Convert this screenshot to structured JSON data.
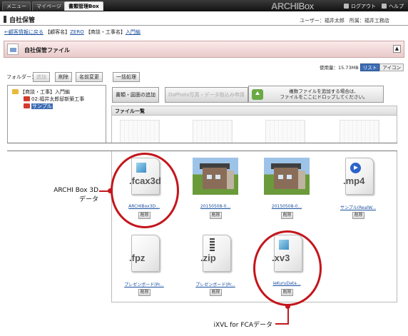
{
  "topbar": {
    "tabs": [
      "メニュー",
      "マイページ",
      "書類管理Box"
    ],
    "brand_a": "ARCHI",
    "brand_b": "Box",
    "logout": "ログアウト",
    "help": "ヘルプ"
  },
  "header": {
    "title": "自社保管",
    "user": "ユーザー：福井太郎　所属：福井工務店"
  },
  "breadcrumb": {
    "back": "←顧客情報に戻る",
    "customer_label": "【顧客名】",
    "customer": "ZERO",
    "deal_label": "【商談・工事名】",
    "deal": "入門編"
  },
  "section": {
    "title": "自社保管ファイル",
    "collapse": "▲"
  },
  "usage": {
    "text": "使用量：15.73MB",
    "list": "リスト",
    "icon": "アイコン"
  },
  "folder_toolbar": {
    "label": "フォルダー：",
    "add": "追加",
    "delete": "削除",
    "rename": "名前変更",
    "bulk": "一括処理"
  },
  "tree": {
    "root": "【商談・工事】入門編",
    "child1": "02:福井太郎邸新築工事",
    "child2": "サンプル"
  },
  "actions": {
    "add_doc": "書類・図面の追加",
    "dophoto": "DoPhoto写真・データ取込み申請",
    "drop_line1": "複数ファイルを追加する場合は、",
    "drop_line2": "ファイルをここにドロップしてください。"
  },
  "filelist": {
    "heading": "ファイル一覧",
    "delete_label": "削除",
    "files": [
      {
        "name": "ARCHIBox3D...",
        "ext": ".fcax3d",
        "kind": "3d"
      },
      {
        "name": "20150508-0...",
        "ext": "",
        "kind": "photo"
      },
      {
        "name": "20150508-0...",
        "ext": "",
        "kind": "photo"
      },
      {
        "name": "サンプル(RealW...",
        "ext": ".mp4",
        "kind": "video"
      },
      {
        "name": "プレゼンボード(Pr...",
        "ext": ".fpz",
        "kind": "fpz"
      },
      {
        "name": "プレゼンボード(Pr...",
        "ext": ".zip",
        "kind": "zip"
      },
      {
        "name": "ieKuruData...",
        "ext": ".xv3",
        "kind": "3d"
      }
    ]
  },
  "annotations": {
    "a1_line1": "ARCHI Box 3D",
    "a1_line2": "データ",
    "a2": "iXVL for FCAデータ",
    "color": "#c3161c"
  }
}
